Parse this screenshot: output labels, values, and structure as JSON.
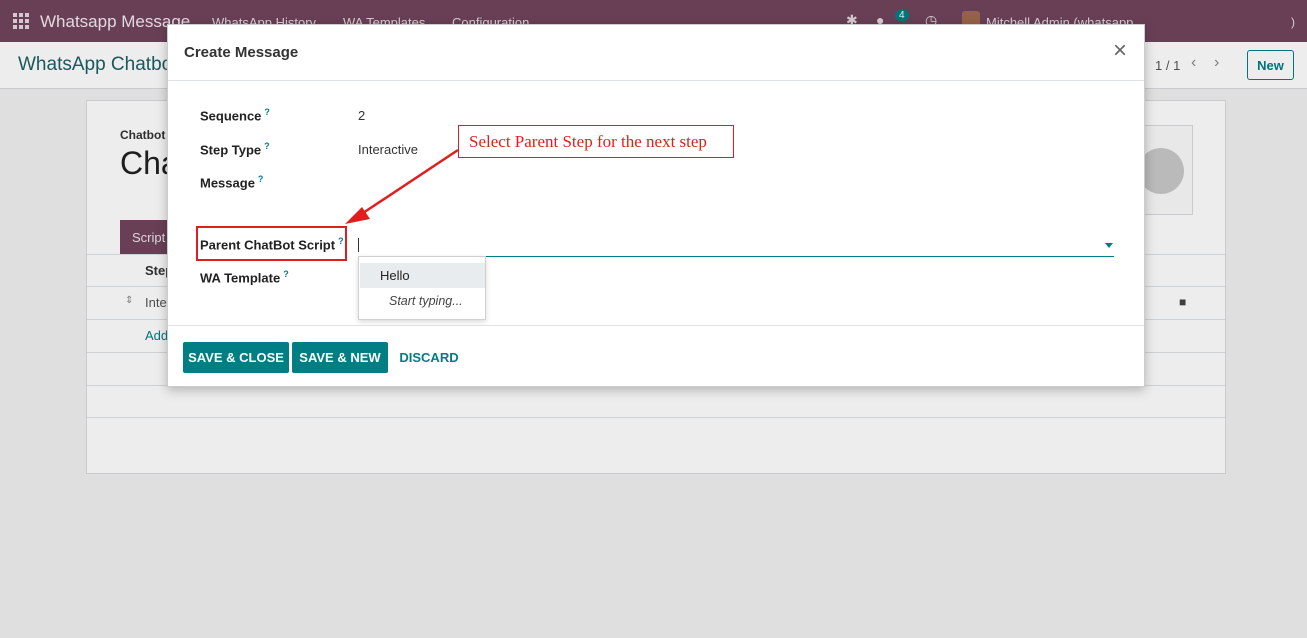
{
  "navbar": {
    "brand": "Whatsapp Message",
    "menu": [
      "WhatsApp History",
      "WA Templates",
      "Configuration"
    ],
    "chat_count": "4",
    "user": "Mitchell Admin (whatsapp",
    "tail": ")",
    "icons": [
      "apps-grid-icon",
      "bug-icon",
      "chat-icon",
      "clock-icon"
    ]
  },
  "control_panel": {
    "title": "WhatsApp Chatbo",
    "pager": "1 / 1",
    "new_label": "New"
  },
  "background_form": {
    "small_label": "Chatbot",
    "big_title": "Cha",
    "tab_label": "Script",
    "column_header": "Step",
    "row_text": "Inte",
    "add_line": "Add"
  },
  "modal": {
    "title": "Create Message",
    "close_glyph": "×",
    "fields": {
      "sequence": {
        "label": "Sequence",
        "value": "2"
      },
      "step_type": {
        "label": "Step Type",
        "value": "Interactive"
      },
      "message": {
        "label": "Message",
        "value": ""
      },
      "parent_script": {
        "label": "Parent ChatBot Script",
        "value": ""
      },
      "wa_template": {
        "label": "WA Template",
        "value": ""
      }
    },
    "help_glyph": "?",
    "autocomplete": {
      "option": "Hello",
      "hint": "Start typing..."
    },
    "buttons": {
      "save_close": "SAVE & CLOSE",
      "save_new": "SAVE & NEW",
      "discard": "DISCARD"
    }
  },
  "annotation": {
    "text": "Select Parent Step for the next step",
    "color": "#e01e1e"
  },
  "colors": {
    "navbar": "#71445d",
    "accent": "#017e84"
  }
}
